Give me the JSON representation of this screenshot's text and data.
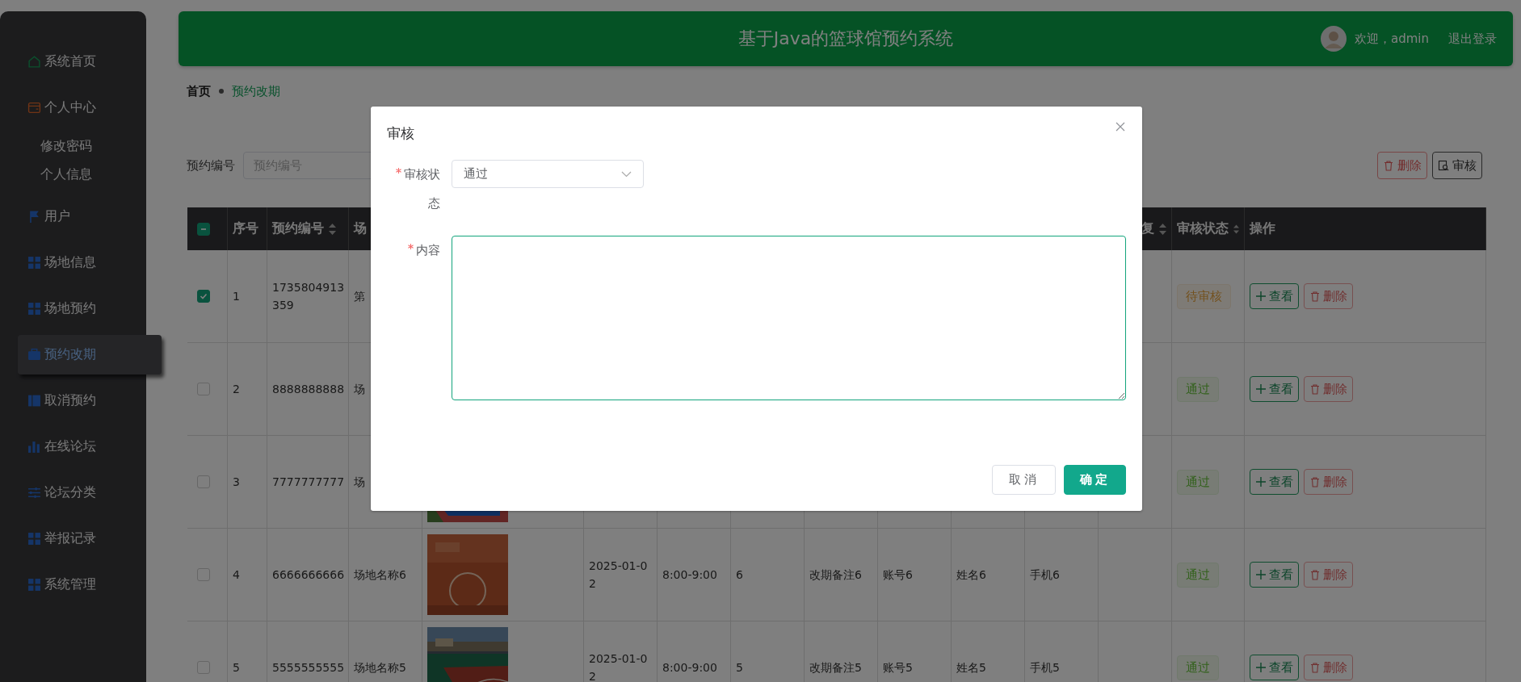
{
  "sidebar": {
    "items": [
      {
        "label": "系统首页",
        "kind": "home",
        "selected": false
      },
      {
        "label": "个人中心",
        "kind": "wallet",
        "selected": false,
        "expanded": true,
        "children": [
          {
            "label": "修改密码",
            "selected": false
          },
          {
            "label": "个人信息",
            "selected": false
          }
        ]
      },
      {
        "label": "用户",
        "kind": "flag",
        "selected": false
      },
      {
        "label": "场地信息",
        "kind": "grid",
        "selected": false
      },
      {
        "label": "场地预约",
        "kind": "grid",
        "selected": false
      },
      {
        "label": "预约改期",
        "kind": "case",
        "selected": true
      },
      {
        "label": "取消预约",
        "kind": "book",
        "selected": false
      },
      {
        "label": "在线论坛",
        "kind": "bars",
        "selected": false
      },
      {
        "label": "论坛分类",
        "kind": "sliders",
        "selected": false
      },
      {
        "label": "举报记录",
        "kind": "grid",
        "selected": false
      },
      {
        "label": "系统管理",
        "kind": "grid",
        "selected": false
      }
    ]
  },
  "header": {
    "title": "基于Java的篮球馆预约系统",
    "greeting": "欢迎，admin",
    "logout": "退出登录"
  },
  "breadcrumb": [
    "首页",
    "预约改期"
  ],
  "search": {
    "label": "预约编号",
    "placeholder": "预约编号"
  },
  "toolbar": [
    {
      "label": "删除",
      "kind": "delete"
    },
    {
      "label": "审核",
      "kind": "review"
    }
  ],
  "table": {
    "header": {
      "select_all_partial": true,
      "index": {
        "label": "序号"
      },
      "booking_no": {
        "label": "预约编号",
        "sortable": true
      },
      "venue": {
        "label": "场"
      },
      "column_13": {
        "label": "复",
        "sortable": true
      },
      "status": {
        "label": "审核状态",
        "sortable": true
      },
      "actions": {
        "label": "操作"
      }
    },
    "rows": [
      {
        "checked": true,
        "index": "1",
        "booking_no": "1735804913359",
        "venue": "第",
        "status": {
          "text": "待审核",
          "kind": "pending"
        },
        "actions": [
          {
            "label": "查看",
            "kind": "view"
          },
          {
            "label": "删除",
            "kind": "delete"
          }
        ]
      },
      {
        "checked": false,
        "index": "2",
        "booking_no": "8888888888",
        "venue": "场",
        "status": {
          "text": "通过",
          "kind": "approved"
        },
        "actions": [
          {
            "label": "查看",
            "kind": "view"
          },
          {
            "label": "删除",
            "kind": "delete"
          }
        ]
      },
      {
        "checked": false,
        "index": "3",
        "booking_no": "7777777777",
        "venue": "场",
        "status": {
          "text": "通过",
          "kind": "approved"
        },
        "actions": [
          {
            "label": "查看",
            "kind": "view"
          },
          {
            "label": "删除",
            "kind": "delete"
          }
        ]
      },
      {
        "checked": false,
        "index": "4",
        "booking_no": "6666666666",
        "venue": "场地名称6",
        "date": "2025-01-02",
        "time": "8:00-9:00",
        "count": "6",
        "note": "改期备注6",
        "account": "账号6",
        "name": "姓名6",
        "phone": "手机6",
        "status": {
          "text": "通过",
          "kind": "approved"
        },
        "actions": [
          {
            "label": "查看",
            "kind": "view"
          },
          {
            "label": "删除",
            "kind": "delete"
          }
        ]
      },
      {
        "checked": false,
        "index": "5",
        "booking_no": "5555555555",
        "venue": "场地名称5",
        "date": "2025-01-02",
        "time": "8:00-9:00",
        "count": "5",
        "note": "改期备注5",
        "account": "账号5",
        "name": "姓名5",
        "phone": "手机5",
        "status": {
          "text": "通过",
          "kind": "approved"
        },
        "actions": [
          {
            "label": "查看",
            "kind": "view"
          },
          {
            "label": "删除",
            "kind": "delete"
          }
        ]
      }
    ]
  },
  "dialog": {
    "title": "审核",
    "fields": [
      {
        "kind": "select",
        "label": "审核状态",
        "required": true,
        "value": "通过"
      },
      {
        "kind": "textarea",
        "label": "内容",
        "required": true,
        "focused": true
      }
    ],
    "buttons": [
      {
        "label": "取消",
        "kind": "default"
      },
      {
        "label": "确定",
        "kind": "primary"
      }
    ]
  }
}
